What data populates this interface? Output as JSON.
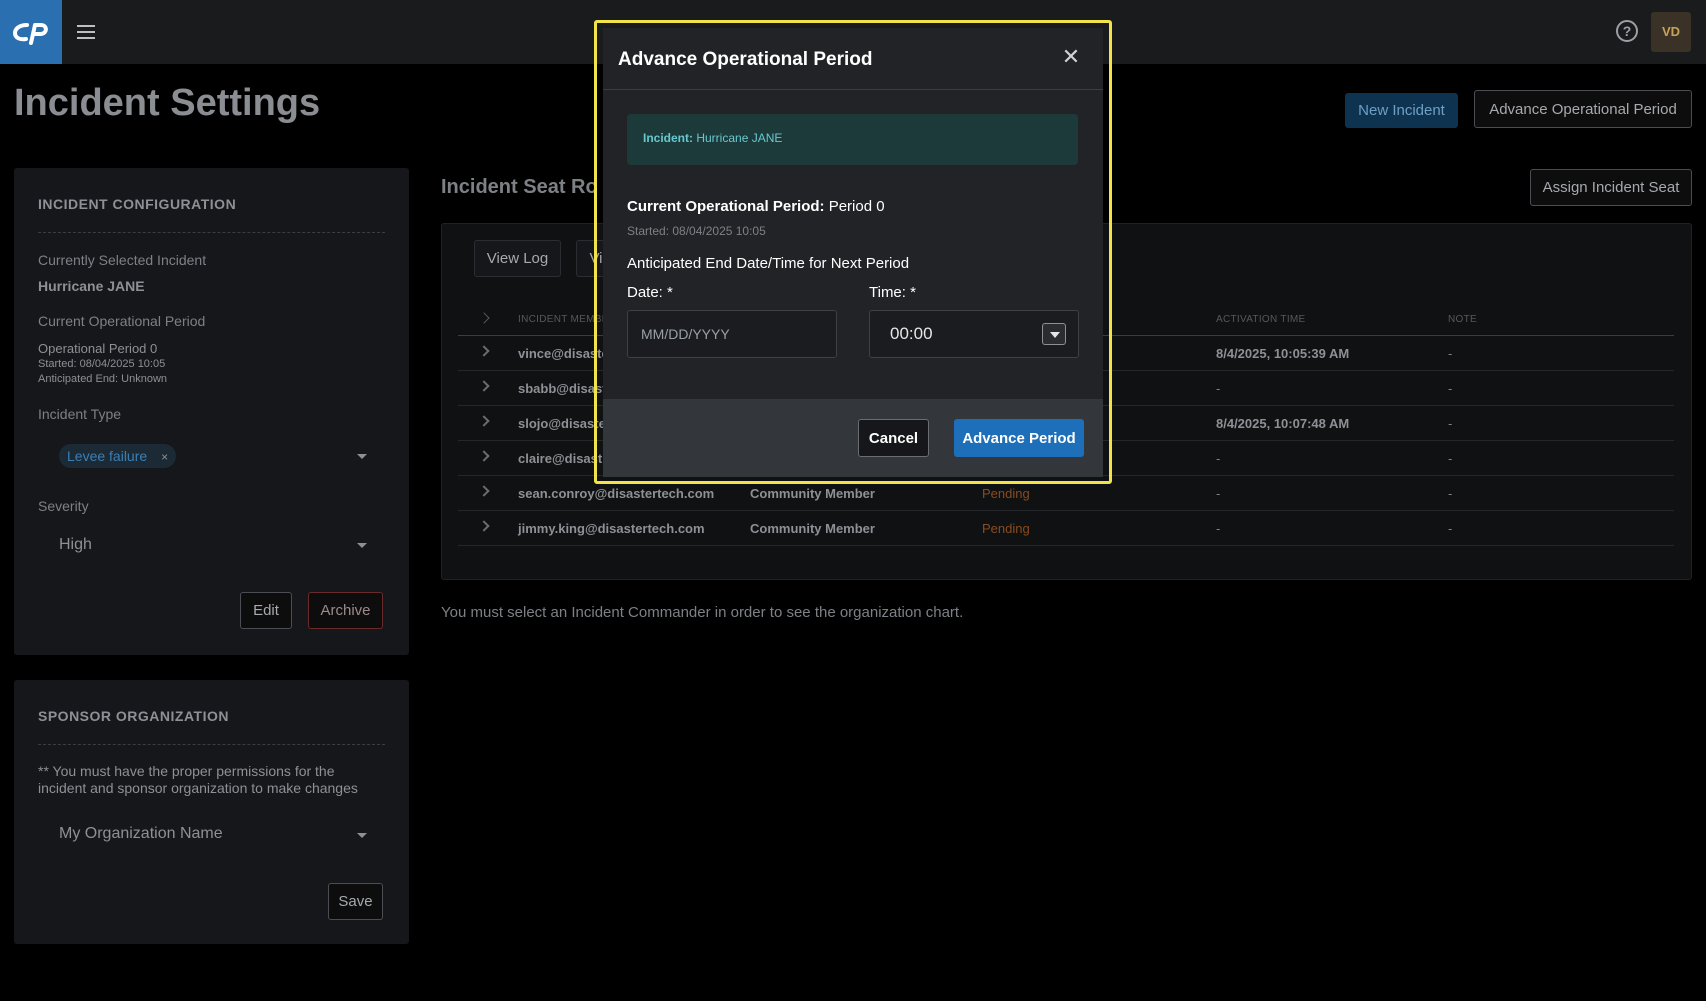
{
  "header": {
    "logo_icon": "cp-logo",
    "menu_icon": "hamburger-menu-icon",
    "help_icon": "help-circle-icon",
    "help_glyph": "?",
    "avatar_initials": "VD"
  },
  "page": {
    "title": "Incident Settings",
    "new_incident_label": "New Incident",
    "advance_period_label": "Advance Operational Period",
    "assign_seat_label": "Assign Incident Seat"
  },
  "config": {
    "title": "INCIDENT CONFIGURATION",
    "selected_label": "Currently Selected Incident",
    "selected_value": "Hurricane JANE",
    "period_label": "Current Operational Period",
    "period_value": "Operational Period 0",
    "period_started": "Started: 08/04/2025 10:05",
    "period_anticipated_end": "Anticipated End: Unknown",
    "type_label": "Incident Type",
    "type_chip": "Levee failure",
    "type_chip_remove": "×",
    "severity_label": "Severity",
    "severity_value": "High",
    "edit_label": "Edit",
    "archive_label": "Archive"
  },
  "sponsor": {
    "title": "SPONSOR ORGANIZATION",
    "note_line1": "** You must have the proper permissions for the",
    "note_line2": "incident and sponsor organization to make changes",
    "org_value": "My Organization Name",
    "save_label": "Save"
  },
  "roster": {
    "title": "Incident Seat Ro",
    "view_log_label": "View Log",
    "view_other_label": "Vi",
    "columns": [
      "INCIDENT MEMBER",
      "ACTIVATION TIME",
      "NOTE"
    ],
    "rows": [
      {
        "member": "vince@disaste",
        "role": "",
        "status": "",
        "activation": "8/4/2025, 10:05:39 AM",
        "note": "-"
      },
      {
        "member": "sbabb@disast",
        "role": "",
        "status": "",
        "activation": "-",
        "note": "-"
      },
      {
        "member": "slojo@disaster",
        "role": "",
        "status": "",
        "activation": "8/4/2025, 10:07:48 AM",
        "note": "-"
      },
      {
        "member": "claire@disast",
        "role": "",
        "status": "",
        "activation": "-",
        "note": "-"
      },
      {
        "member": "sean.conroy@disastertech.com",
        "role": "Community Member",
        "status": "Pending",
        "activation": "-",
        "note": "-"
      },
      {
        "member": "jimmy.king@disastertech.com",
        "role": "Community Member",
        "status": "Pending",
        "activation": "-",
        "note": "-"
      }
    ],
    "org_chart_note": "You must select an Incident Commander in order to see the organization chart."
  },
  "modal": {
    "title": "Advance Operational Period",
    "close_glyph": "✕",
    "incident_label": "Incident:",
    "incident_value": "Hurricane JANE",
    "current_period_label": "Current Operational Period:",
    "current_period_value": "Period 0",
    "started": "Started: 08/04/2025 10:05",
    "next_period_heading": "Anticipated End Date/Time for Next Period",
    "date_label": "Date: *",
    "date_placeholder": "MM/DD/YYYY",
    "time_label": "Time: *",
    "time_value": "00:00",
    "cancel_label": "Cancel",
    "advance_label": "Advance Period"
  },
  "colors": {
    "modal_highlight": "#f2e34a",
    "primary": "#1c6fb8",
    "pending": "#8a4b1e"
  }
}
